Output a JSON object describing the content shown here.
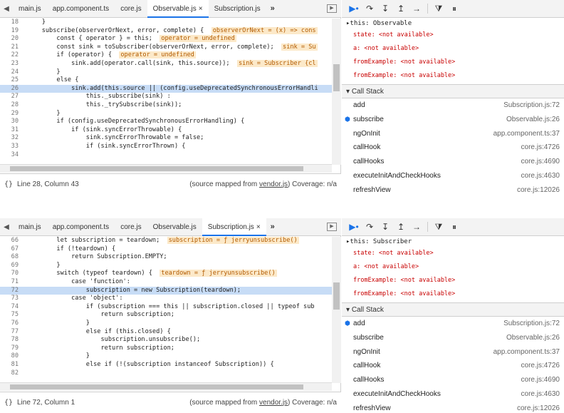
{
  "panels": [
    {
      "tabs": [
        "main.js",
        "app.component.ts",
        "core.js",
        "Observable.js",
        "Subscription.js"
      ],
      "active_tab": 3,
      "tab_close": "×",
      "tab_more": "»",
      "status": {
        "position": "Line 28, Column 43",
        "source_prefix": "(source mapped from ",
        "source_link": "vendor.js",
        "source_suffix": ")",
        "coverage": "Coverage: n/a"
      },
      "code": [
        {
          "n": "18",
          "t": "    }"
        },
        {
          "n": "19",
          "t": "    subscribe(observerOrNext, error, complete) {",
          "a": "observerOrNext = (x) => cons"
        },
        {
          "n": "20",
          "t": "        const { operator } = this;",
          "a": "operator = undefined"
        },
        {
          "n": "21",
          "t": "        const sink = toSubscriber(observerOrNext, error, complete);",
          "a": "sink = Su"
        },
        {
          "n": "22",
          "t": "        if (operator) {",
          "a": "operator = undefined"
        },
        {
          "n": "23",
          "t": "            sink.add(operator.call(sink, this.source));",
          "a": "sink = Subscriber {cl"
        },
        {
          "n": "24",
          "t": "        }"
        },
        {
          "n": "25",
          "t": "        else {"
        },
        {
          "n": "26",
          "t": "            sink.add(this.source || (config.useDeprecatedSynchronousErrorHandli",
          "hl": true
        },
        {
          "n": "27",
          "t": "                this._subscribe(sink) :"
        },
        {
          "n": "28",
          "t": "                this._trySubscribe(sink));"
        },
        {
          "n": "29",
          "t": "        }"
        },
        {
          "n": "30",
          "t": "        if (config.useDeprecatedSynchronousErrorHandling) {"
        },
        {
          "n": "31",
          "t": "            if (sink.syncErrorThrowable) {"
        },
        {
          "n": "32",
          "t": "                sink.syncErrorThrowable = false;"
        },
        {
          "n": "33",
          "t": "                if (sink.syncErrorThrown) {"
        },
        {
          "n": "34",
          "t": ""
        }
      ],
      "scope": {
        "this": "this: Observable",
        "props": [
          "state: <not available>",
          "a: <not available>",
          "fromExample: <not available>",
          "fromExample: <not available>"
        ]
      },
      "call_stack_label": "Call Stack",
      "frames": [
        {
          "name": "add",
          "loc": "Subscription.js:72",
          "current": false
        },
        {
          "name": "subscribe",
          "loc": "Observable.js:26",
          "current": true
        },
        {
          "name": "ngOnInit",
          "loc": "app.component.ts:37",
          "current": false
        },
        {
          "name": "callHook",
          "loc": "core.js:4726",
          "current": false
        },
        {
          "name": "callHooks",
          "loc": "core.js:4690",
          "current": false
        },
        {
          "name": "executeInitAndCheckHooks",
          "loc": "core.js:4630",
          "current": false
        },
        {
          "name": "refreshView",
          "loc": "core.js:12026",
          "current": false
        }
      ]
    },
    {
      "tabs": [
        "main.js",
        "app.component.ts",
        "core.js",
        "Observable.js",
        "Subscription.js"
      ],
      "active_tab": 4,
      "tab_close": "×",
      "tab_more": "»",
      "status": {
        "position": "Line 72, Column 1",
        "source_prefix": "(source mapped from ",
        "source_link": "vendor.js",
        "source_suffix": ")",
        "coverage": "Coverage: n/a"
      },
      "code": [
        {
          "n": "66",
          "t": "        let subscription = teardown;",
          "a": "subscription = ƒ jerryunsubscribe()"
        },
        {
          "n": "67",
          "t": "        if (!teardown) {"
        },
        {
          "n": "68",
          "t": "            return Subscription.EMPTY;"
        },
        {
          "n": "69",
          "t": "        }"
        },
        {
          "n": "70",
          "t": "        switch (typeof teardown) {",
          "a": "teardown = ƒ jerryunsubscribe()"
        },
        {
          "n": "71",
          "t": "            case 'function':"
        },
        {
          "n": "72",
          "t": "                subscription = new Subscription(teardown);",
          "hl": true
        },
        {
          "n": "73",
          "t": "            case 'object':"
        },
        {
          "n": "74",
          "t": "                if (subscription === this || subscription.closed || typeof sub"
        },
        {
          "n": "75",
          "t": "                    return subscription;"
        },
        {
          "n": "76",
          "t": "                }"
        },
        {
          "n": "77",
          "t": "                else if (this.closed) {"
        },
        {
          "n": "78",
          "t": "                    subscription.unsubscribe();"
        },
        {
          "n": "79",
          "t": "                    return subscription;"
        },
        {
          "n": "80",
          "t": "                }"
        },
        {
          "n": "81",
          "t": "                else if (!(subscription instanceof Subscription)) {"
        },
        {
          "n": "82",
          "t": ""
        }
      ],
      "scope": {
        "this": "this: Subscriber",
        "props": [
          "state: <not available>",
          "a: <not available>",
          "fromExample: <not available>",
          "fromExample: <not available>"
        ]
      },
      "call_stack_label": "Call Stack",
      "frames": [
        {
          "name": "add",
          "loc": "Subscription.js:72",
          "current": true
        },
        {
          "name": "subscribe",
          "loc": "Observable.js:26",
          "current": false
        },
        {
          "name": "ngOnInit",
          "loc": "app.component.ts:37",
          "current": false
        },
        {
          "name": "callHook",
          "loc": "core.js:4726",
          "current": false
        },
        {
          "name": "callHooks",
          "loc": "core.js:4690",
          "current": false
        },
        {
          "name": "executeInitAndCheckHooks",
          "loc": "core.js:4630",
          "current": false
        },
        {
          "name": "refreshView",
          "loc": "core.js:12026",
          "current": false
        }
      ]
    }
  ],
  "icons": {
    "navigator_toggle": "navigator-toggle-icon",
    "resume": "resume-icon",
    "step_over": "step-over-icon",
    "step_into": "step-into-icon",
    "step_out": "step-out-icon",
    "step": "step-icon",
    "deactivate_breakpoints": "deactivate-breakpoints-icon",
    "pause_exceptions": "pause-on-exceptions-icon",
    "current_frame": "current-frame-arrow-icon",
    "accent": "#1a73e8"
  }
}
